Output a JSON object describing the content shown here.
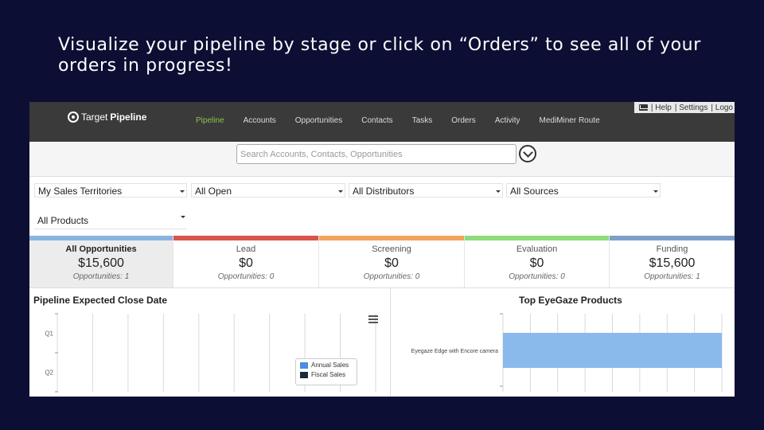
{
  "slide": {
    "caption": "Visualize your pipeline by stage  or click on “Orders” to see all of your orders in progress!"
  },
  "utility": {
    "help": "| Help",
    "settings": "| Settings",
    "logout": "| Logo"
  },
  "brand": {
    "part1": "Target",
    "part2": "Pipeline"
  },
  "nav": [
    {
      "label": "Pipeline",
      "active": true
    },
    {
      "label": "Accounts"
    },
    {
      "label": "Opportunities"
    },
    {
      "label": "Contacts"
    },
    {
      "label": "Tasks"
    },
    {
      "label": "Orders"
    },
    {
      "label": "Activity"
    },
    {
      "label": "MediMiner Route"
    }
  ],
  "search": {
    "placeholder": "Search Accounts, Contacts, Opportunities"
  },
  "filters": {
    "territories": "My Sales Territories",
    "status": "All Open",
    "distributors": "All Distributors",
    "sources": "All Sources",
    "products": "All Products"
  },
  "stages": [
    {
      "name": "All Opportunities",
      "amount": "$15,600",
      "count": "Opportunities: 1",
      "color": "#8ab4e0"
    },
    {
      "name": "Lead",
      "amount": "$0",
      "count": "Opportunities: 0",
      "color": "#d9534f"
    },
    {
      "name": "Screening",
      "amount": "$0",
      "count": "Opportunities: 0",
      "color": "#f0a45c"
    },
    {
      "name": "Evaluation",
      "amount": "$0",
      "count": "Opportunities: 0",
      "color": "#8fdc7a"
    },
    {
      "name": "Funding",
      "amount": "$15,600",
      "count": "Opportunities: 1",
      "color": "#7f9fc9"
    }
  ],
  "chart_data": [
    {
      "type": "bar",
      "title": "Pipeline Expected Close Date",
      "categories": [
        "Q1",
        "Q2"
      ],
      "series": [
        {
          "name": "Annual Sales",
          "values": [
            0,
            0
          ],
          "color": "#4a8fd8"
        },
        {
          "name": "Fiscal Sales",
          "values": [
            0,
            0
          ],
          "color": "#1b2a3a"
        }
      ],
      "legend": "bottom-right",
      "grid": true
    },
    {
      "type": "bar",
      "orientation": "horizontal",
      "title": "Top EyeGaze Products",
      "categories": [
        "Eyegaze Edge with Encore camera"
      ],
      "values": [
        15600
      ],
      "color": "#8ab9ec",
      "grid": true
    }
  ]
}
